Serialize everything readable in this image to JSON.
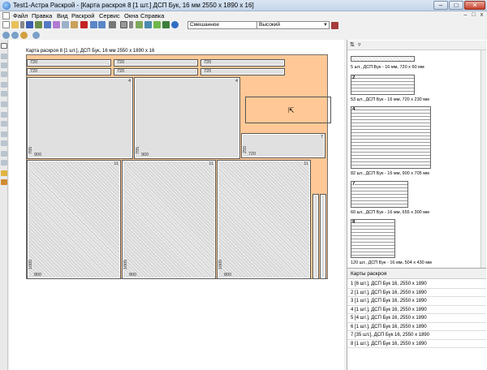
{
  "window": {
    "title": "Test1-Астра Раскрой - [Карта раскроя 8 [1 шт.]  ДСП Бук, 16 мм 2550 x 1890 x 16]",
    "minimize": "–",
    "maximize": "□",
    "close": "✕",
    "mdi_close": "x"
  },
  "menu": [
    "Файл",
    "Правка",
    "Вид",
    "Раскрой",
    "Сервис",
    "Окна",
    "Справка"
  ],
  "toolbar": {
    "mode_select": "Смешанное",
    "quality_select": "Высокий"
  },
  "map": {
    "label": "Карта раскроя 8 [1 шт.], ДСП Бук, 16 мм 2550 x 1890 x 16",
    "strips": [
      {
        "row": 1,
        "labels": [
          "720",
          "720",
          "720"
        ]
      },
      {
        "row": 2,
        "labels": [
          "720",
          "720",
          "720"
        ]
      }
    ],
    "parts": [
      {
        "num": "4",
        "w": "900",
        "h": "705"
      },
      {
        "num": "4",
        "w": "900",
        "h": "705"
      },
      {
        "num": "7",
        "w": "720",
        "h": "255"
      },
      {
        "num": "11",
        "w": "800",
        "h": "1005"
      },
      {
        "num": "11",
        "w": "800",
        "h": "1005"
      },
      {
        "num": "11",
        "w": "800",
        "h": "1005"
      }
    ]
  },
  "right_panel": {
    "thumbs": [
      {
        "num": "",
        "caption": "5 шт., ДСП Бук - 16 мм, 720 x 60 мм"
      },
      {
        "num": "2",
        "caption": "53 шт., ДСП Бук - 16 мм, 720 x 230 мм"
      },
      {
        "num": "4",
        "caption": "82 шт., ДСП Бук - 16 мм, 900 x 705 мм"
      },
      {
        "num": "7",
        "caption": "60 шт., ДСП Бук - 16 мм, 655 x 300 мм"
      },
      {
        "num": "8",
        "caption": "120 шт., ДСП Бук - 16 мм, 504 x 430 мм"
      }
    ],
    "cards_header": "Карты раскроя",
    "cards": [
      "1 [6 шт.], ДСП Бук 16, 2550 x 1890",
      "2 [1 шт.], ДСП Бук 16, 2550 x 1890",
      "3 [1 шт.], ДСП Бук 16, 2550 x 1890",
      "4 [1 шт.], ДСП Бук 16, 2550 x 1890",
      "5 [4 шт.], ДСП Бук 16, 2550 x 1890",
      "6 [1 шт.], ДСП Бук 16, 2550 x 1890",
      "7 [35 шт.], ДСП Бук 16, 2550 x 1890",
      "8 [1 шт.], ДСП Бук 16, 2550 x 1890"
    ]
  },
  "colors": {
    "sheet": "#ffc896",
    "part": "#e0e0e0",
    "selection": "#555555"
  }
}
